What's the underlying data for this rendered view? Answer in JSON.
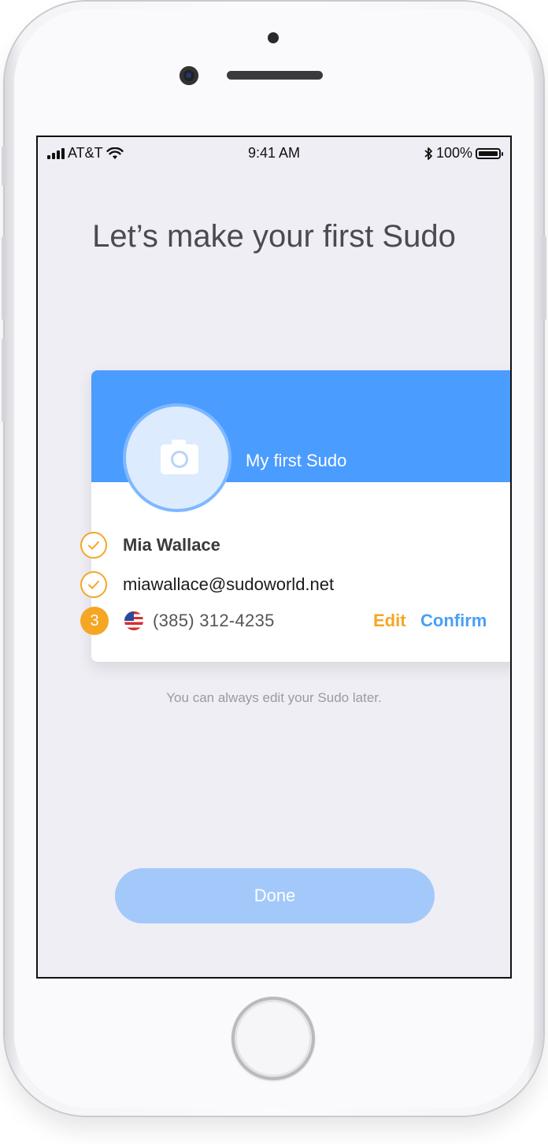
{
  "status_bar": {
    "carrier": "AT&T",
    "time": "9:41 AM",
    "battery": "100%"
  },
  "onboarding": {
    "heading": "Let’s make your first Sudo",
    "card": {
      "title": "My first Sudo",
      "name": "Mia Wallace",
      "email": "miawallace@sudoworld.net",
      "step_number": "3",
      "phone": "(385) 312-4235",
      "edit_label": "Edit",
      "confirm_label": "Confirm"
    },
    "hint": "You can always edit your Sudo later.",
    "done_label": "Done"
  },
  "colors": {
    "accent_blue": "#4b9cff",
    "accent_orange": "#f5a623",
    "done_disabled": "#a3c9fa",
    "screen_bg": "#efeef4"
  },
  "icons": [
    "signal-bars-icon",
    "wifi-icon",
    "bluetooth-icon",
    "battery-icon",
    "camera-icon",
    "checkmark-icon",
    "us-flag-icon"
  ]
}
